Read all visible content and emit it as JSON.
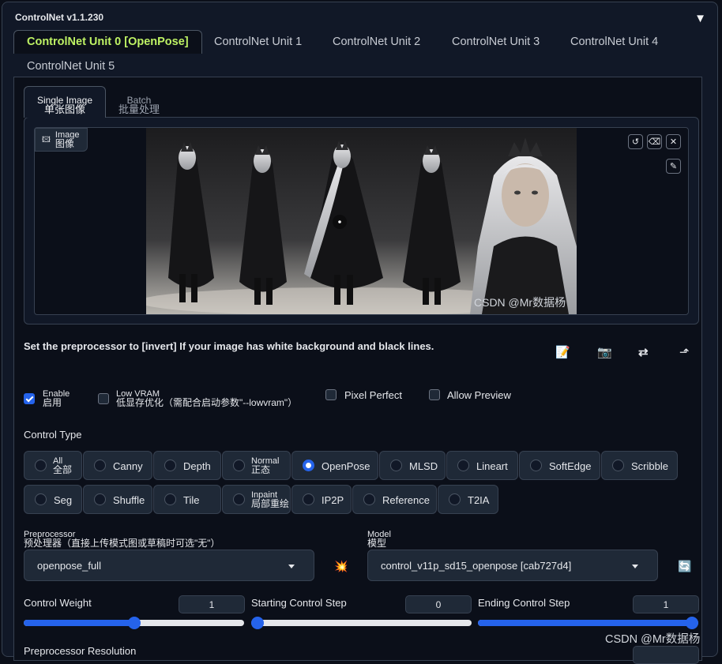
{
  "panel": {
    "title": "ControlNet v1.1.230",
    "collapse_icon": "▼"
  },
  "unit_tabs": [
    "ControlNet Unit 0 [OpenPose]",
    "ControlNet Unit 1",
    "ControlNet Unit 2",
    "ControlNet Unit 3",
    "ControlNet Unit 4",
    "ControlNet Unit 5"
  ],
  "input_tabs": [
    {
      "en": "Single Image",
      "cn": "单张图像"
    },
    {
      "en": "Batch",
      "cn": "批量处理"
    }
  ],
  "image": {
    "en": "Image",
    "cn": "图像",
    "watermark": "CSDN @Mr数据杨"
  },
  "hint": "Set the preprocessor to [invert] If your image has white background and black lines.",
  "options": {
    "enable_en": "Enable",
    "enable_cn": "启用",
    "enable_checked": true,
    "lowvram_en": "Low VRAM",
    "lowvram_cn": "低显存优化（需配合启动参数\"--lowvram\"）",
    "pixel_perfect": "Pixel Perfect",
    "allow_preview": "Allow Preview"
  },
  "control_type": {
    "label": "Control Type",
    "selected": "OpenPose",
    "row1": [
      {
        "en": "All",
        "cn": "全部"
      },
      {
        "en": "Canny"
      },
      {
        "en": "Depth"
      },
      {
        "en": "Normal",
        "cn": "正态"
      },
      {
        "en": "OpenPose"
      },
      {
        "en": "MLSD"
      },
      {
        "en": "Lineart"
      },
      {
        "en": "SoftEdge"
      },
      {
        "en": "Scribble"
      }
    ],
    "row2": [
      {
        "en": "Seg"
      },
      {
        "en": "Shuffle"
      },
      {
        "en": "Tile"
      },
      {
        "en": "Inpaint",
        "cn": "局部重绘"
      },
      {
        "en": "IP2P"
      },
      {
        "en": "Reference"
      },
      {
        "en": "T2IA"
      }
    ]
  },
  "preprocessor": {
    "en": "Preprocessor",
    "cn": "预处理器（直接上传模式图或草稿时可选\"无\"）",
    "value": "openpose_full"
  },
  "model": {
    "en": "Model",
    "cn": "模型",
    "value": "control_v11p_sd15_openpose [cab727d4]"
  },
  "sliders": {
    "weight": {
      "label": "Control Weight",
      "value": "1",
      "fraction": 0.5
    },
    "start": {
      "label": "Starting Control Step",
      "value": "0",
      "fraction": 0.0
    },
    "end": {
      "label": "Ending Control Step",
      "value": "1",
      "fraction": 1.0
    }
  },
  "bottom_label": "Preprocessor Resolution",
  "page_watermark": "CSDN @Mr数据杨",
  "icons": {
    "edit": "📝",
    "camera": "📷",
    "swap": "⇄",
    "send": "⬏",
    "undo": "↺",
    "eraser": "⌫",
    "close": "✕",
    "brush": "✎",
    "explode": "💥",
    "refresh": "🔄"
  },
  "colors": {
    "accent": "#2563eb",
    "active_tab": "#bef264",
    "background": "#0b0f19",
    "panel": "#111827"
  }
}
